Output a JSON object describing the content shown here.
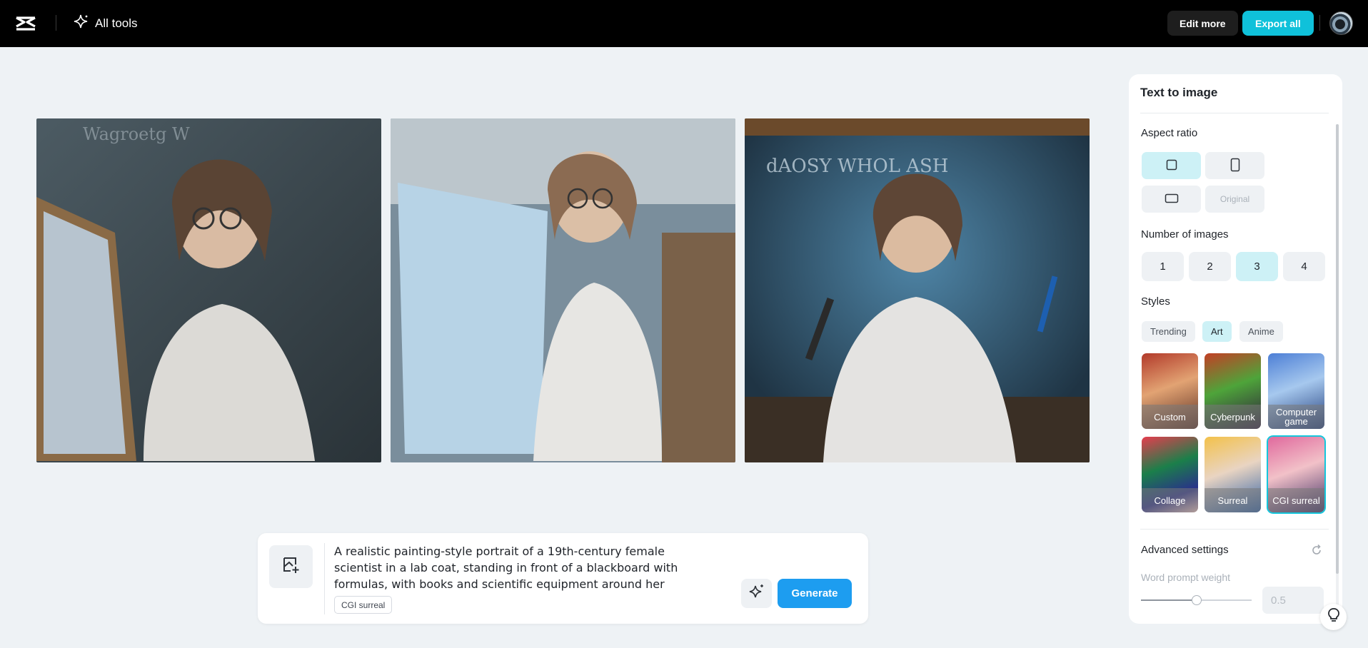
{
  "topbar": {
    "logo_icon": "capcut-logo-icon",
    "all_tools_label": "All tools",
    "edit_more_label": "Edit more",
    "export_all_label": "Export all"
  },
  "images": [
    {
      "description_icon": "generated-image",
      "palette": [
        "#3a4a52",
        "#c9b39a",
        "#e9e6e1"
      ]
    },
    {
      "description_icon": "generated-image",
      "palette": [
        "#8ea6b8",
        "#d4c2ae",
        "#eef0ef"
      ]
    },
    {
      "description_icon": "generated-image",
      "palette": [
        "#34526a",
        "#c7a98c",
        "#e8e8ea"
      ]
    }
  ],
  "prompt": {
    "text": "A realistic painting-style portrait of a 19th-century female scientist in a lab coat, standing in front of a blackboard with formulas, with books and scientific equipment around her",
    "style_tag": "CGI surreal",
    "generate_label": "Generate"
  },
  "panel": {
    "title": "Text to image",
    "aspect_ratio_label": "Aspect ratio",
    "aspect_ratio_options": [
      "square",
      "portrait",
      "landscape",
      "Original"
    ],
    "aspect_ratio_selected": "square",
    "num_images_label": "Number of images",
    "num_images_options": [
      "1",
      "2",
      "3",
      "4"
    ],
    "num_images_selected": "3",
    "styles_label": "Styles",
    "style_tabs": [
      "Trending",
      "Art",
      "Anime"
    ],
    "style_tab_selected": "Art",
    "style_cards": [
      "Custom",
      "Cyberpunk",
      "Computer game",
      "Collage",
      "Surreal",
      "CGI surreal"
    ],
    "style_card_selected": "CGI surreal",
    "advanced_label": "Advanced settings",
    "word_prompt_weight_label": "Word prompt weight",
    "word_prompt_weight_value": "0.5",
    "word_prompt_weight_fraction": 0.5
  },
  "colors": {
    "accent": "#0fc1da",
    "generate": "#1d9df0",
    "selected_bg": "#cdf1f6"
  }
}
